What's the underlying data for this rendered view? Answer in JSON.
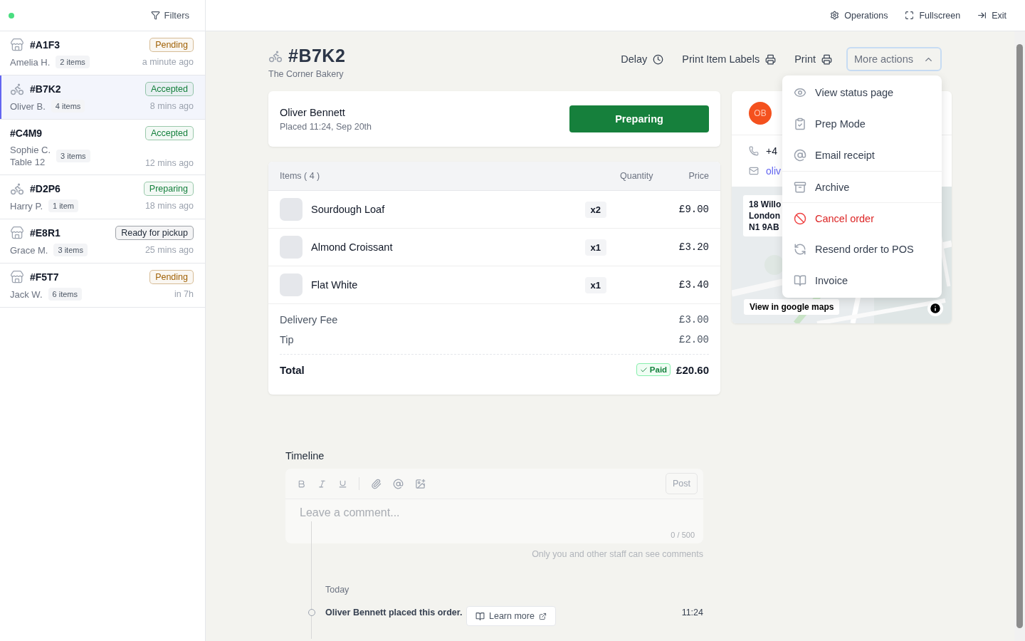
{
  "sidebar": {
    "online": true,
    "filters_label": "Filters",
    "orders": [
      {
        "code": "#A1F3",
        "kind": "store",
        "status": "Pending",
        "color": "#a16207",
        "customer": "Amelia H.",
        "items": "2 items",
        "time": "a minute ago",
        "selected": false
      },
      {
        "code": "#B7K2",
        "kind": "bike",
        "status": "Accepted",
        "color": "#15803d",
        "customer": "Oliver B.",
        "items": "4 items",
        "time": "8 mins ago",
        "selected": true
      },
      {
        "code": "#C4M9",
        "kind": "table",
        "status": "Accepted",
        "color": "#15803d",
        "customer": "Sophie C.",
        "table": "Table 12",
        "items": "3 items",
        "time": "12 mins ago",
        "selected": false
      },
      {
        "code": "#D2P6",
        "kind": "bike",
        "status": "Preparing",
        "color": "#15803d",
        "customer": "Harry P.",
        "items": "1 item",
        "time": "18 mins ago",
        "selected": false
      },
      {
        "code": "#E8R1",
        "kind": "store",
        "status": "Ready for pickup",
        "color": "#1f2937",
        "customer": "Grace M.",
        "items": "3 items",
        "time": "25 mins ago",
        "selected": false
      },
      {
        "code": "#F5T7",
        "kind": "store",
        "status": "Pending",
        "color": "#a16207",
        "customer": "Jack W.",
        "items": "6 items",
        "time": "in 7h",
        "selected": false
      }
    ]
  },
  "topbar": {
    "actions": [
      "Operations",
      "Fullscreen",
      "Exit"
    ]
  },
  "order": {
    "code": "#B7K2",
    "kind": "bike",
    "store": "The Corner Bakery",
    "actions": [
      "Delay",
      "Print Item Labels",
      "Print"
    ],
    "more_actions": {
      "label": "More actions",
      "expanded": true,
      "items": [
        {
          "label": "View status page",
          "kind": "normal",
          "divider_before": false
        },
        {
          "label": "Prep Mode",
          "kind": "normal",
          "divider_before": false
        },
        {
          "label": "Email receipt",
          "kind": "normal",
          "divider_before": false
        },
        {
          "label": "Archive",
          "kind": "normal",
          "divider_before": true
        },
        {
          "label": "Cancel order",
          "kind": "danger",
          "divider_before": true
        },
        {
          "label": "Resend order to POS",
          "kind": "normal",
          "divider_before": false
        },
        {
          "label": "Invoice",
          "kind": "normal",
          "divider_before": false
        }
      ]
    },
    "customer": "Oliver Bennett",
    "placed": "Placed 11:24, Sep 20th",
    "status_button": "Preparing",
    "items_header": {
      "title": "Items ( 4 )",
      "quantity": "Quantity",
      "price": "Price"
    },
    "items": [
      {
        "name": "Sourdough Loaf",
        "qty": "x2",
        "price": "£9.00"
      },
      {
        "name": "Almond Croissant",
        "qty": "x1",
        "price": "£3.20"
      },
      {
        "name": "Flat White",
        "qty": "x1",
        "price": "£3.40"
      }
    ],
    "fees": [
      {
        "label": "Delivery Fee",
        "value": "£3.00"
      },
      {
        "label": "Tip",
        "value": "£2.00"
      }
    ],
    "total": {
      "label": "Total",
      "paid": true,
      "paid_label": "Paid",
      "value": "£20.60"
    }
  },
  "customer_card": {
    "initials": "OB",
    "phone": "+4",
    "email": "oliv",
    "address": [
      "18 Willo",
      "London",
      "N1 9AB"
    ],
    "map_button": "View in google maps"
  },
  "timeline": {
    "title": "Timeline",
    "post": "Post",
    "placeholder": "Leave a comment...",
    "counter": "0 / 500",
    "note": "Only you and other staff can see comments",
    "day": "Today",
    "events": [
      {
        "text": "Oliver Bennett placed this order.",
        "time": "11:24"
      }
    ],
    "learn_more": "Learn more"
  }
}
